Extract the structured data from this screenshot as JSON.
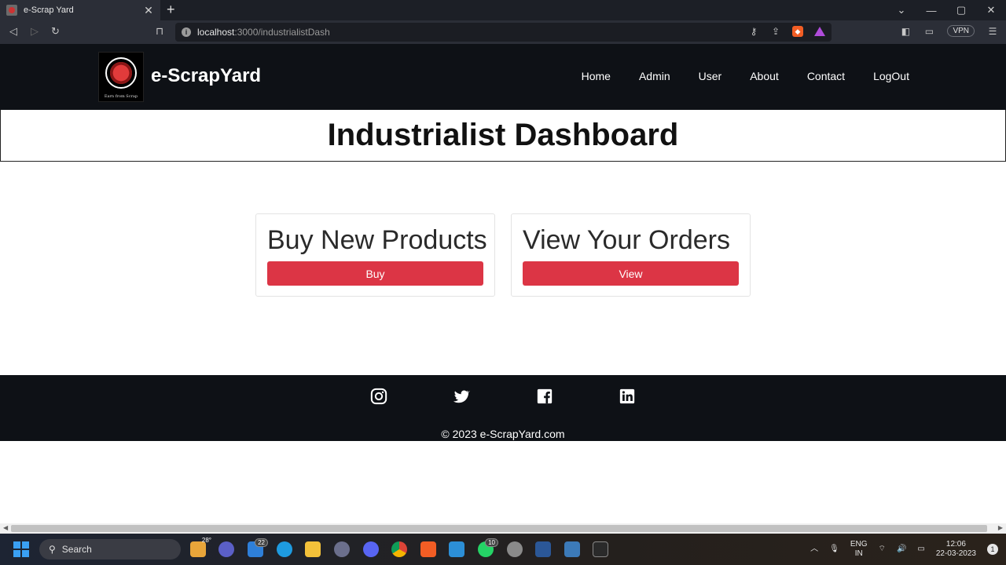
{
  "browser": {
    "tab_title": "e-Scrap Yard",
    "tab_close": "✕",
    "new_tab": "+",
    "url_host": "localhost",
    "url_path": ":3000/industrialistDash",
    "vpn_label": "VPN",
    "window_controls": [
      "⌄",
      "—",
      "▢",
      "✕"
    ]
  },
  "site": {
    "brand": "e-ScrapYard",
    "logo_caption": "Earn from Scrap",
    "nav": [
      "Home",
      "Admin",
      "User",
      "About",
      "Contact",
      "LogOut"
    ]
  },
  "main": {
    "title": "Industrialist Dashboard",
    "cards": [
      {
        "title": "Buy New Products",
        "button": "Buy"
      },
      {
        "title": "View Your Orders",
        "button": "View"
      }
    ]
  },
  "footer": {
    "copyright": "© 2023 e-ScrapYard.com",
    "social_icons": [
      "instagram-icon",
      "twitter-icon",
      "facebook-icon",
      "linkedin-icon"
    ]
  },
  "taskbar": {
    "search_label": "Search",
    "weather_temp": "28°",
    "mail_badge": "22",
    "whatsapp_badge": "10",
    "language_top": "ENG",
    "language_bottom": "IN",
    "time": "12:06",
    "date": "22-03-2023",
    "notification_count": "1"
  },
  "colors": {
    "accent_button": "#dc3545",
    "header_bg": "#0e1116"
  }
}
